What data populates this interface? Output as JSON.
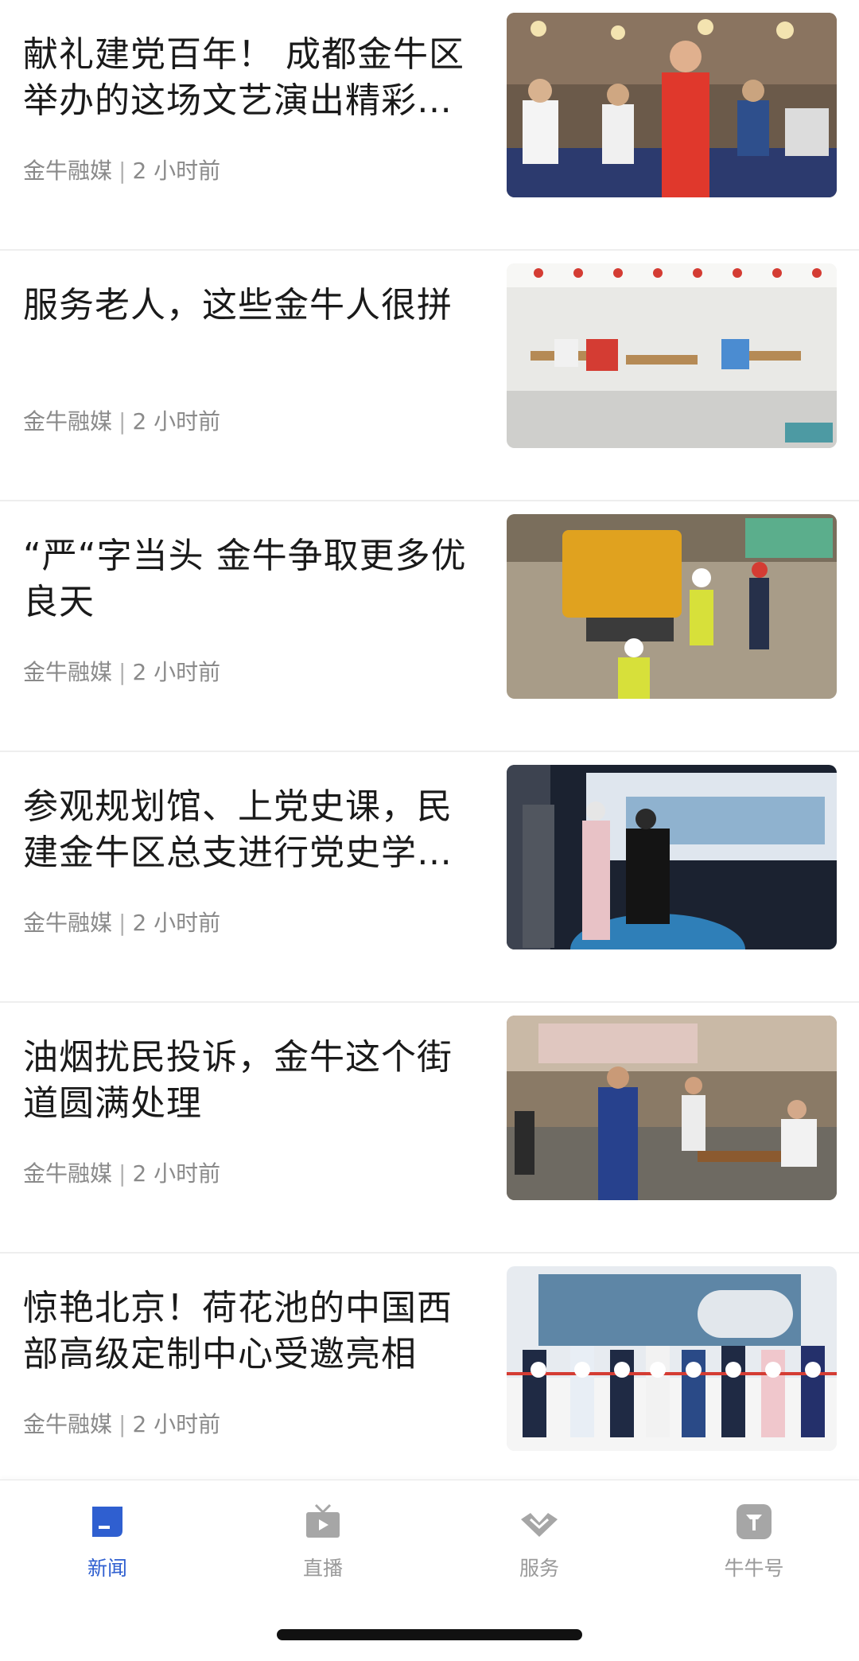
{
  "feed": {
    "articles": [
      {
        "title": " 献礼建党百年！ 成都金牛区举办的这场文艺演出精彩纷呈",
        "source": "金牛融媒",
        "separator": "|",
        "time": "2 小时前"
      },
      {
        "title": "服务老人，这些金牛人很拼",
        "source": "金牛融媒",
        "separator": "|",
        "time": "2 小时前"
      },
      {
        "title": "“严“字当头  金牛争取更多优良天",
        "source": "金牛融媒",
        "separator": "|",
        "time": "2 小时前"
      },
      {
        "title": "参观规划馆、上党史课，民建金牛区总支进行党史学习教育",
        "source": "金牛融媒",
        "separator": "|",
        "time": "2 小时前"
      },
      {
        "title": "油烟扰民投诉，金牛这个街道圆满处理",
        "source": "金牛融媒",
        "separator": "|",
        "time": "2 小时前"
      },
      {
        "title": "惊艳北京！荷花池的中国西部高级定制中心受邀亮相",
        "source": "金牛融媒",
        "separator": "|",
        "time": "2 小时前"
      }
    ]
  },
  "tabbar": {
    "tabs": [
      {
        "label": "新闻",
        "icon": "news-icon",
        "active": true
      },
      {
        "label": "直播",
        "icon": "tv-icon",
        "active": false
      },
      {
        "label": "服务",
        "icon": "service-icon",
        "active": false
      },
      {
        "label": "牛牛号",
        "icon": "niuniu-icon",
        "active": false
      }
    ]
  },
  "colors": {
    "accent": "#2f5fd0",
    "inactive": "#9a9a9a",
    "meta": "#8a8a8a",
    "title": "#1a1a1a"
  }
}
